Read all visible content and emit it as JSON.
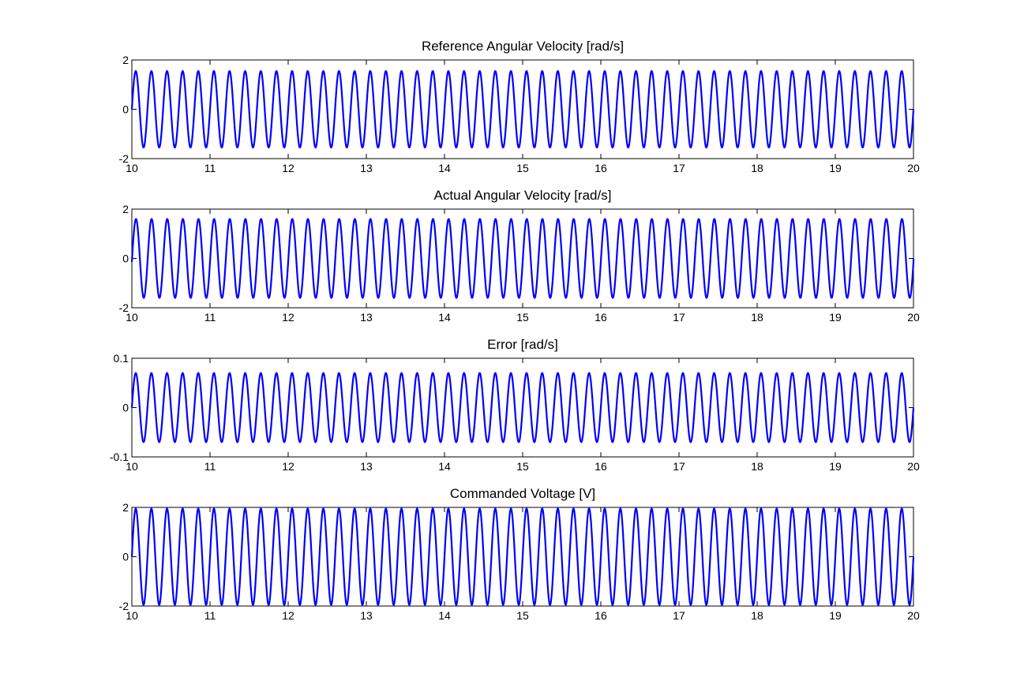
{
  "chart_data": [
    {
      "type": "line",
      "title": "Reference Angular Velocity [rad/s]",
      "xlabel": "",
      "ylabel": "",
      "xlim": [
        10,
        20
      ],
      "ylim": [
        -2,
        2
      ],
      "xticks": [
        "10",
        "11",
        "12",
        "13",
        "14",
        "15",
        "16",
        "17",
        "18",
        "19",
        "20"
      ],
      "yticks": [
        "-2",
        "0",
        "2"
      ],
      "grid": false,
      "series": [
        {
          "color": "#0000ff",
          "amplitude": 1.55,
          "frequency_hz": 5,
          "phase_deg": 0,
          "x_range": [
            10,
            20
          ],
          "y_end": 0
        }
      ]
    },
    {
      "type": "line",
      "title": "Actual Angular Velocity [rad/s]",
      "xlabel": "",
      "ylabel": "",
      "xlim": [
        10,
        20
      ],
      "ylim": [
        -2,
        2
      ],
      "xticks": [
        "10",
        "11",
        "12",
        "13",
        "14",
        "15",
        "16",
        "17",
        "18",
        "19",
        "20"
      ],
      "yticks": [
        "-2",
        "0",
        "2"
      ],
      "grid": false,
      "series": [
        {
          "color": "#0000ff",
          "amplitude": 1.6,
          "frequency_hz": 5,
          "phase_deg": -5,
          "x_range": [
            10,
            20
          ],
          "y_end": 0
        }
      ]
    },
    {
      "type": "line",
      "title": "Error [rad/s]",
      "xlabel": "",
      "ylabel": "",
      "xlim": [
        10,
        20
      ],
      "ylim": [
        -0.1,
        0.1
      ],
      "xticks": [
        "10",
        "11",
        "12",
        "13",
        "14",
        "15",
        "16",
        "17",
        "18",
        "19",
        "20"
      ],
      "yticks": [
        "-0.1",
        "0",
        "0.1"
      ],
      "grid": false,
      "series": [
        {
          "color": "#0000ff",
          "amplitude": 0.07,
          "frequency_hz": 5,
          "phase_deg": 0,
          "x_range": [
            10,
            20
          ],
          "y_end": 0
        }
      ]
    },
    {
      "type": "line",
      "title": "Commanded Voltage [V]",
      "xlabel": "",
      "ylabel": "",
      "xlim": [
        10,
        20
      ],
      "ylim": [
        -2,
        2
      ],
      "xticks": [
        "10",
        "11",
        "12",
        "13",
        "14",
        "15",
        "16",
        "17",
        "18",
        "19",
        "20"
      ],
      "yticks": [
        "-2",
        "0",
        "2"
      ],
      "grid": false,
      "series": [
        {
          "color": "#0000ff",
          "amplitude": 1.95,
          "frequency_hz": 5,
          "phase_deg": 0,
          "x_range": [
            10,
            20
          ],
          "y_end": 0
        }
      ]
    }
  ]
}
